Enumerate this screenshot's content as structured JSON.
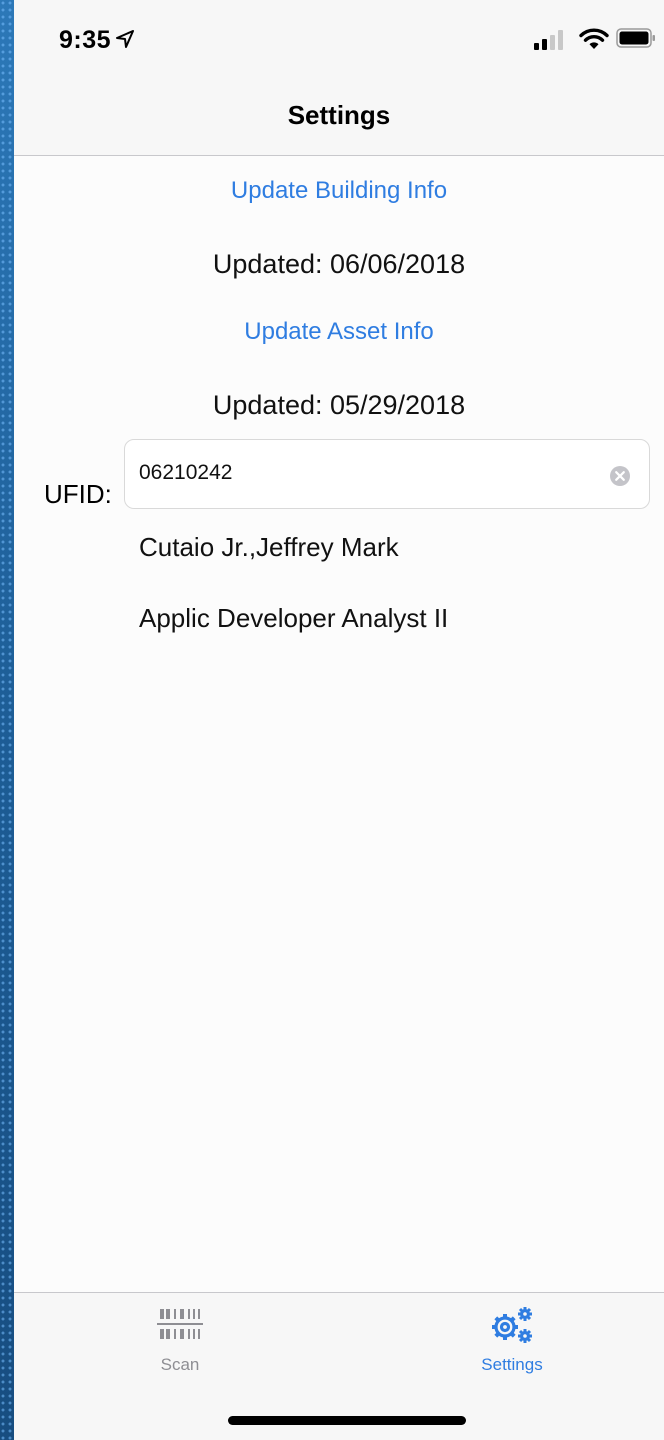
{
  "status_bar": {
    "time": "9:35"
  },
  "nav": {
    "title": "Settings"
  },
  "content": {
    "update_building_label": "Update Building Info",
    "building_updated": "Updated: 06/06/2018",
    "update_asset_label": "Update Asset Info",
    "asset_updated": "Updated: 05/29/2018",
    "ufid_label": "UFID:",
    "ufid_value": "06210242",
    "employee_name": "Cutaio Jr.,Jeffrey Mark",
    "employee_title": "Applic Developer Analyst II"
  },
  "tab_bar": {
    "tabs": [
      {
        "label": "Scan",
        "icon": "barcode-icon",
        "selected": false
      },
      {
        "label": "Settings",
        "icon": "gears-icon",
        "selected": true
      }
    ]
  },
  "colors": {
    "accent": "#2f7de1",
    "inactive_tab": "#8e8e93",
    "bar_background": "#f7f7f7"
  }
}
